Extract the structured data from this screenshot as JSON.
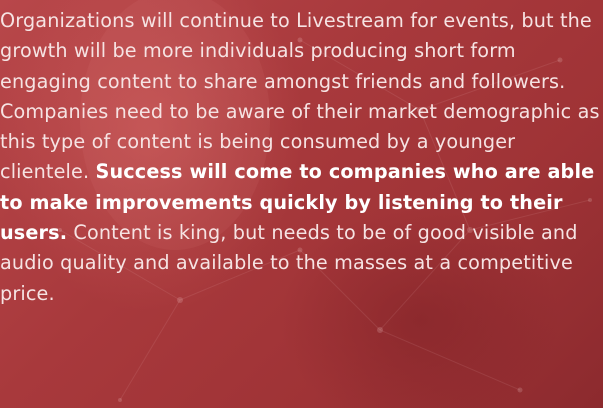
{
  "paragraph": {
    "intro": "Organizations will continue to Livestream for events, but the growth will be more individuals producing short form engaging content to share amongst friends and followers. Companies need to be aware of their market demographic as this type of content is being consumed by a younger clientele.",
    "highlight": "Success will come to companies who are able to make improvements quickly by listening to their users.",
    "outro": "Content is king, but needs to be of good visible and audio quality and available to the masses at a competitive price."
  },
  "colors": {
    "background": "#a8393c",
    "text": "#f6e3e3",
    "highlight_text": "#ffffff"
  }
}
